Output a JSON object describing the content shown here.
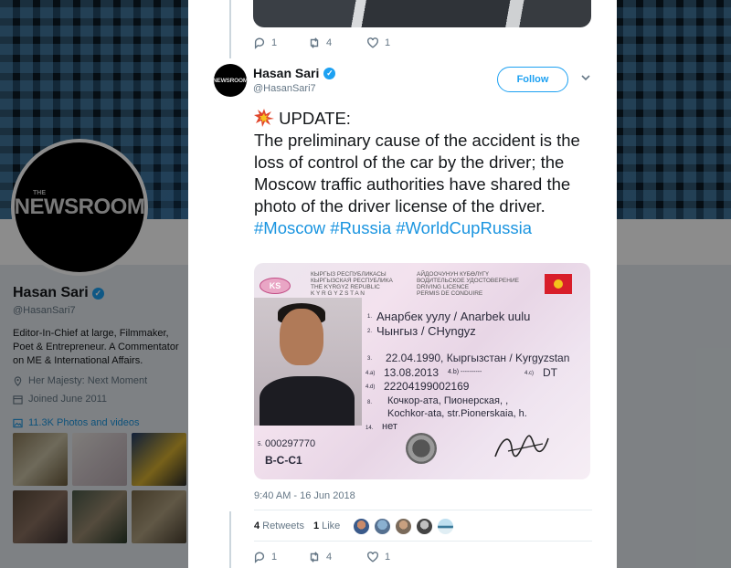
{
  "profile": {
    "name": "Hasan Sari",
    "handle": "@HasanSari7",
    "avatar_text": "NEWSROOM",
    "avatar_small_text": "THE",
    "bio": "Editor-In-Chief at large, Filmmaker, Poet & Entrepreneur. A Commentator on ME & International Affairs.",
    "location": "Her Majesty: Next Moment",
    "joined": "Joined June 2011",
    "media_link": "11.3K Photos and videos"
  },
  "previous_tweet": {
    "replies": "1",
    "retweets": "4",
    "likes": "1"
  },
  "tweet": {
    "author": "Hasan Sari",
    "handle": "@HasanSari7",
    "avatar_text": "NEWSROOM",
    "follow_label": "Follow",
    "update_label": "UPDATE:",
    "body": "The preliminary cause of the accident is the loss of control of the car by the driver; the Moscow traffic authorities have shared the photo of the driver license of the driver.",
    "hashtags": [
      "#Moscow",
      "#Russia",
      "#WorldCupRussia"
    ],
    "timestamp": "9:40 AM - 16 Jun 2018",
    "retweet_count": "4",
    "retweet_label": "Retweets",
    "like_count": "1",
    "like_label": "Like",
    "replies": "1",
    "retweets": "4",
    "likes": "1"
  },
  "license": {
    "header_left": [
      "КЫРГЫЗ РЕСПУБЛИКАСЫ",
      "КЫРГЫЗСКАЯ РЕСПУБЛИКА",
      "THE KYRGYZ REPUBLIC",
      "K Y R G Y Z S T A N"
    ],
    "header_right": [
      "АЙДООЧУНУН КҮБӨЛҮГҮ",
      "ВОДИТЕЛЬСКОЕ УДОСТОВЕРЕНИЕ",
      "DRIVING LICENCE",
      "PERMIS DE CONDUIRE"
    ],
    "badge": "KS",
    "line1": "Анарбек уулу / Anarbek uulu",
    "line2": "Чынгыз / CHyngyz",
    "line3": "22.04.1990, Кыргызстан / Kyrgyzstan",
    "line4a": "13.08.2013",
    "line4b": "4.b) ----------",
    "line4c": "DT",
    "line4d": "22204199002169",
    "line8a": "Кочкор-ата, Пионерская, ,",
    "line8b": "Kochkor-ata, str.Pionerskaia, h.",
    "line14": "нет",
    "serial": "000297770",
    "categories": "B-C-C1",
    "n1": "1.",
    "n2": "2.",
    "n3": "3.",
    "n4a": "4.a)",
    "n4c": "4.c)",
    "n4d": "4.d)",
    "n8": "8.",
    "n14": "14.",
    "n5": "5."
  },
  "colors": {
    "accent": "#1da1f2",
    "link": "#1b95e0",
    "muted": "#657786"
  }
}
